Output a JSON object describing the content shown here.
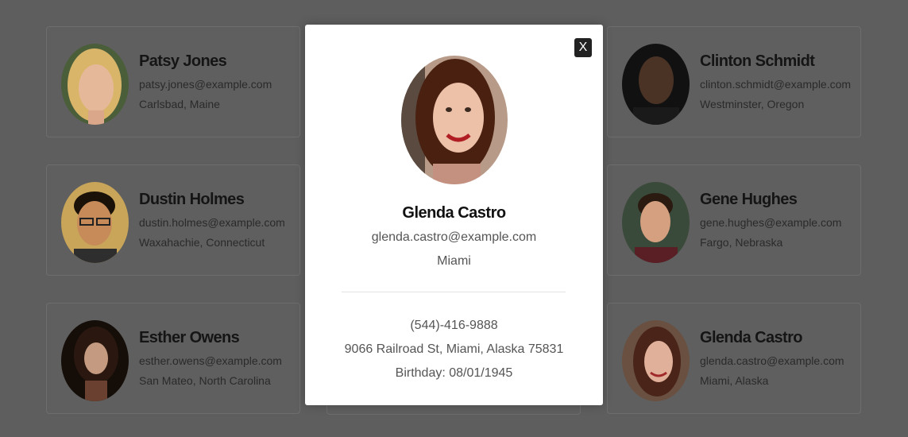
{
  "cards": [
    {
      "name": "Patsy Jones",
      "email": "patsy.jones@example.com",
      "location": "Carlsbad, Maine"
    },
    {
      "name": "Clinton Schmidt",
      "email": "clinton.schmidt@example.com",
      "location": "Westminster, Oregon"
    },
    {
      "name": "Dustin Holmes",
      "email": "dustin.holmes@example.com",
      "location": "Waxahachie, Connecticut"
    },
    {
      "name": "Gene Hughes",
      "email": "gene.hughes@example.com",
      "location": "Fargo, Nebraska"
    },
    {
      "name": "Esther Owens",
      "email": "esther.owens@example.com",
      "location": "San Mateo, North Carolina"
    },
    {
      "name": "Glenda Castro",
      "email": "glenda.castro@example.com",
      "location": "Miami, Alaska"
    }
  ],
  "modal": {
    "close_label": "X",
    "name": "Glenda Castro",
    "email": "glenda.castro@example.com",
    "city": "Miami",
    "phone": "(544)-416-9888",
    "address": "9066 Railroad St, Miami, Alaska 75831",
    "birthday": "Birthday: 08/01/1945"
  },
  "colors": {
    "overlay": "#5e5e5e",
    "modal_bg": "#ffffff",
    "close_button": "#222222"
  }
}
